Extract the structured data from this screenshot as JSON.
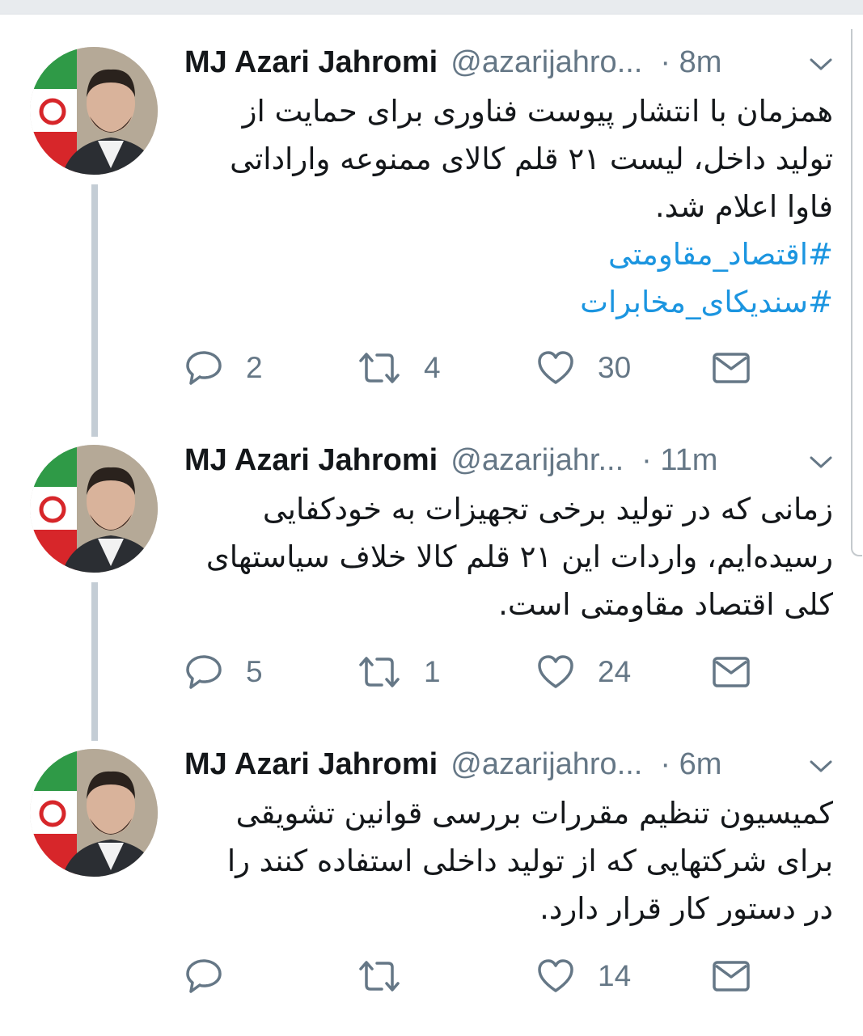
{
  "tweets": [
    {
      "author": "MJ Azari Jahromi",
      "handle": "@azarijahro...",
      "time": "· 8m",
      "text_lines": [
        "همزمان با انتشار پیوست فناوری برای حمایت از",
        "تولید داخل، لیست ۲۱ قلم کالای ممنوعه واراداتی",
        "فاوا اعلام شد."
      ],
      "hashtags": [
        "#اقتصاد_مقاومتی",
        "#سندیکای_مخابرات"
      ],
      "replies": "2",
      "retweets": "4",
      "likes": "30"
    },
    {
      "author": "MJ Azari Jahromi",
      "handle": "@azarijahr...",
      "time": "· 11m",
      "text_lines": [
        "زمانی که در تولید برخی تجهیزات به خودکفایی",
        "رسیده‌ایم، واردات این ۲۱ قلم کالا خلاف سیاستهای",
        "کلی اقتصاد مقاومتی است."
      ],
      "hashtags": [],
      "replies": "5",
      "retweets": "1",
      "likes": "24"
    },
    {
      "author": "MJ Azari Jahromi",
      "handle": "@azarijahro...",
      "time": "· 6m",
      "text_lines": [
        "کمیسیون تنظیم مقررات بررسی قوانین تشویقی",
        "برای شرکتهایی که از تولید داخلی استفاده کنند را",
        "در دستور کار قرار دارد."
      ],
      "hashtags": [],
      "replies": "",
      "retweets": "",
      "likes": "14"
    }
  ],
  "icons": {
    "reply": "reply-icon",
    "retweet": "retweet-icon",
    "like": "heart-icon",
    "dm": "envelope-icon",
    "caret": "chevron-down-icon"
  },
  "colors": {
    "text": "#14171a",
    "muted": "#657786",
    "link": "#1b95e0",
    "thread_line": "#c4cdd5"
  }
}
